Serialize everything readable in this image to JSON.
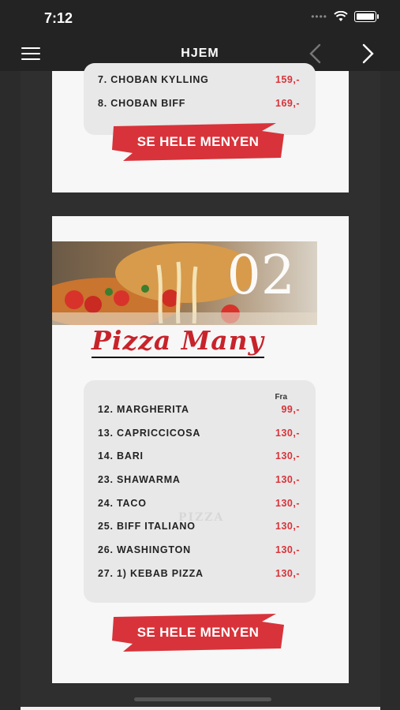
{
  "status": {
    "time": "7:12"
  },
  "nav": {
    "title": "HJEM"
  },
  "top_card": {
    "items": [
      {
        "name": "7. CHOBAN KYLLING",
        "price": "159,-"
      },
      {
        "name": "8. CHOBAN BIFF",
        "price": "169,-"
      }
    ],
    "cta_label": "SE HELE MENYEN"
  },
  "pizza_card": {
    "banner_number": "02",
    "title": "Pizza Many",
    "price_header": "Fra",
    "watermark": "PIZZA",
    "items": [
      {
        "name": "12. MARGHERITA",
        "price": "99,-"
      },
      {
        "name": "13. CAPRICCICOSA",
        "price": "130,-"
      },
      {
        "name": "14. BARI",
        "price": "130,-"
      },
      {
        "name": "23. SHAWARMA",
        "price": "130,-"
      },
      {
        "name": "24. TACO",
        "price": "130,-"
      },
      {
        "name": "25. BIFF ITALIANO",
        "price": "130,-"
      },
      {
        "name": "26. WASHINGTON",
        "price": "130,-"
      },
      {
        "name": "27. 1) KEBAB PIZZA",
        "price": "130,-"
      }
    ],
    "cta_label": "SE HELE MENYEN"
  },
  "colors": {
    "accent_red": "#d8333a",
    "bar_dark": "#232323"
  }
}
